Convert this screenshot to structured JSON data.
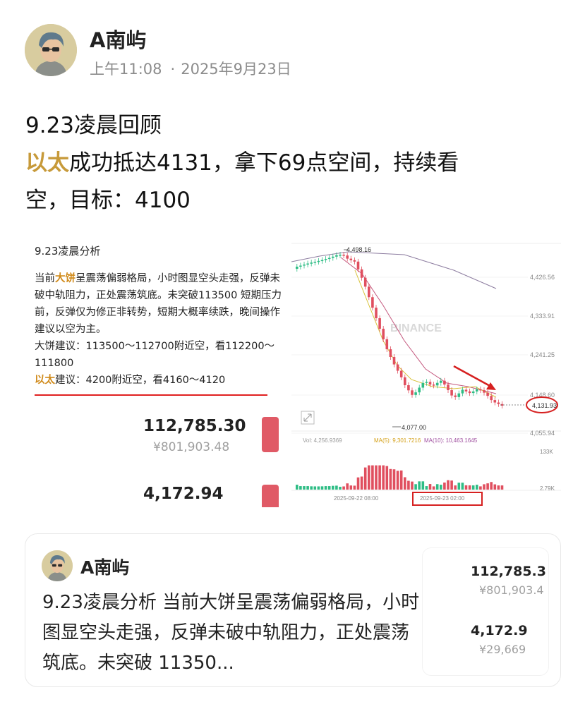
{
  "post": {
    "author": "A南屿",
    "time": "上午11:08",
    "date": "2025年9月23日",
    "line1": "9.23凌晨回顾",
    "highlight": "以太",
    "line2_rest": "成功抵达4131，拿下69点空间，持续看",
    "line3": "空，目标：4100",
    "highlight_color": "#c79a3a"
  },
  "analysis": {
    "title": "9.23凌晨分析",
    "p1_before": "当前",
    "p1_hl": "大饼",
    "p1_after": "呈震荡偏弱格局，小时图显空头走强，反弹未破中轨阻力，正处震荡筑底。未突破113500 短期压力前，反弹仅为修正非转势，短期大概率续跌，晚间操作建议以空为主。",
    "p2": "大饼建议：113500～112700附近空，看112200～111800",
    "p3_hl": "以太",
    "p3_rest": "建议：4200附近空，看4160～4120",
    "btc_price": "112,785.30",
    "btc_cny": "¥801,903.48",
    "eth_price": "4,172.94"
  },
  "chart": {
    "watermark": "BINANCE",
    "high_label": "4,498.16",
    "low_label": "4,077.00",
    "y_ticks": [
      "4,426.56",
      "4,333.91",
      "4,241.25",
      "4,148.60",
      "4,055.94"
    ],
    "current_price": "4,131.93",
    "vol_label": "Vol: 4,256.9369",
    "ma5_label": "MA(5): 9,301.7216",
    "ma10_label": "MA(10): 10,463.1645",
    "vol_ticks": [
      "133K",
      "2.79K"
    ],
    "x_labels": [
      "2025-09-22 08:00",
      "2025-09-23 02:00"
    ],
    "up_color": "#2ebd85",
    "down_color": "#e04f5f"
  },
  "repost": {
    "author": "A南屿",
    "text": "9.23凌晨分析 当前大饼呈震荡偏弱格局，小时图显空头走强，反弹未破中轨阻力，正处震荡筑底。未突破 11350...",
    "thumb_btc": "112,785.3",
    "thumb_btc_cny": "¥801,903.4",
    "thumb_eth": "4,172.9",
    "thumb_eth_cny": "¥29,669"
  }
}
